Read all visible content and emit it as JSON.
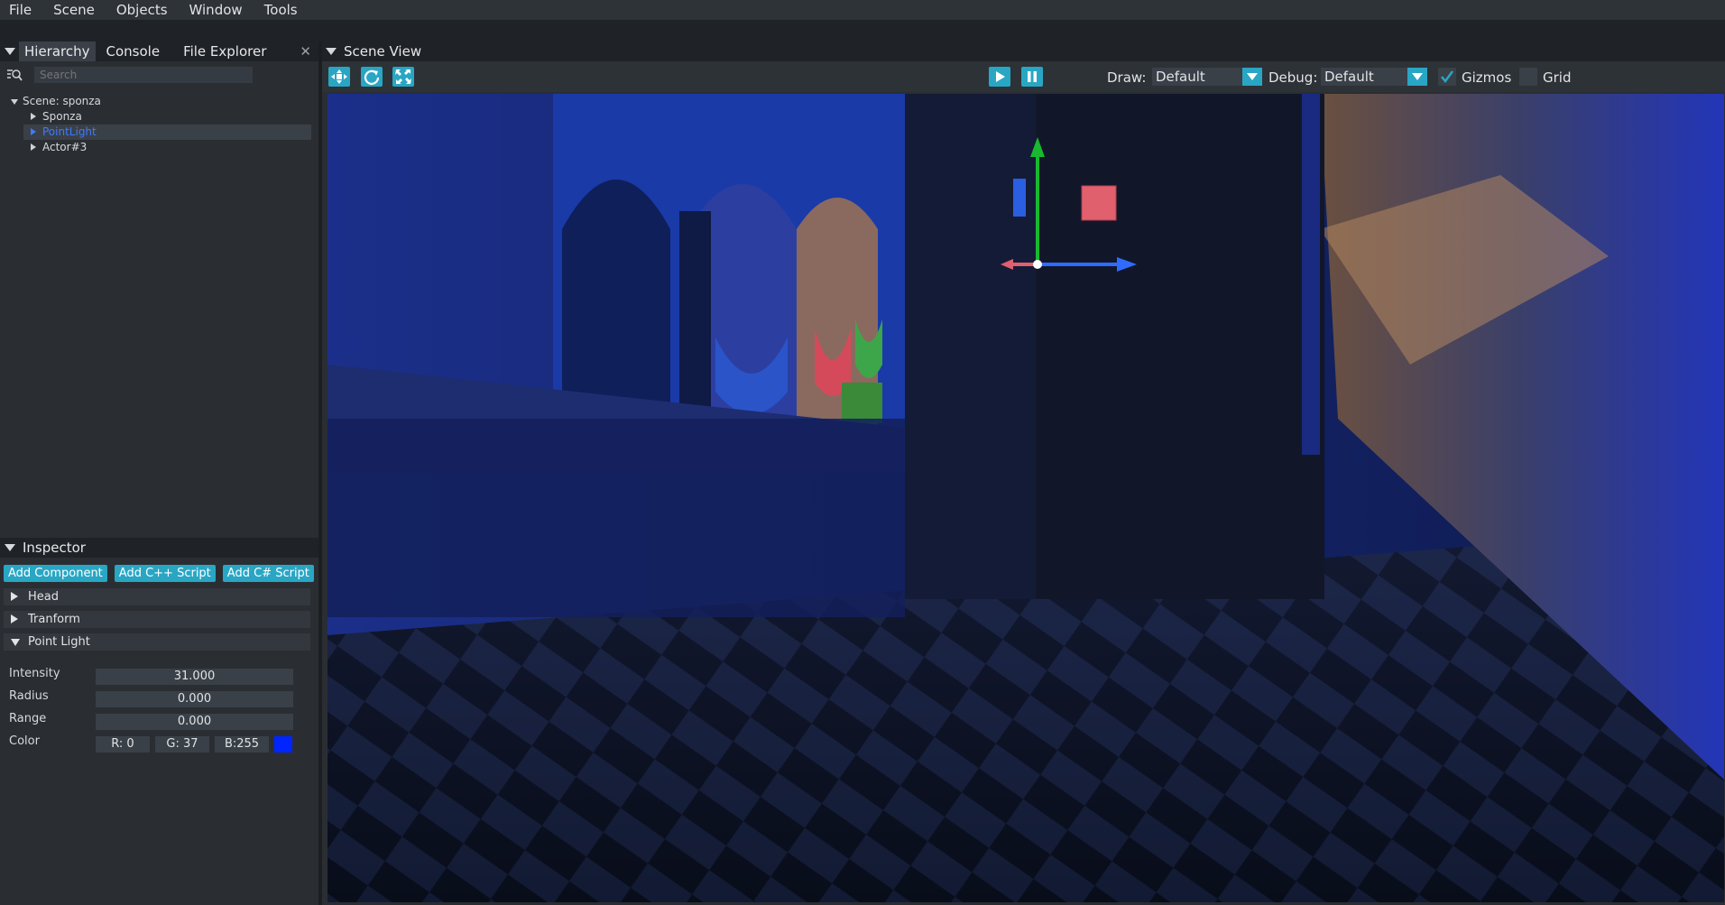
{
  "menu": [
    "File",
    "Scene",
    "Objects",
    "Window",
    "Tools"
  ],
  "left_tabs": {
    "hierarchy": "Hierarchy",
    "console": "Console",
    "file_explorer": "File Explorer",
    "close": "✕"
  },
  "search": {
    "placeholder": "Search"
  },
  "tree": {
    "scene": "Scene: sponza",
    "children": [
      "Sponza",
      "PointLight",
      "Actor#3"
    ],
    "selected_index": 1
  },
  "inspector": {
    "title": "Inspector",
    "buttons": [
      "Add Component",
      "Add C++ Script",
      "Add C# Script"
    ],
    "sections": [
      "Head",
      "Tranform",
      "Point Light"
    ],
    "props": {
      "intensity_label": "Intensity",
      "intensity": "31.000",
      "radius_label": "Radius",
      "radius": "0.000",
      "range_label": "Range",
      "range": "0.000",
      "color_label": "Color",
      "r": "R:  0",
      "g": "G: 37",
      "b": "B:255"
    },
    "color_hex": "#0025ff"
  },
  "scene_view": {
    "title": "Scene View",
    "draw_label": "Draw:",
    "draw_value": "Default",
    "debug_label": "Debug:",
    "debug_value": "Default",
    "gizmos_label": "Gizmos",
    "gizmos_checked": true,
    "grid_label": "Grid",
    "grid_checked": false
  },
  "colors": {
    "accent": "#29a6c4",
    "selected": "#3c7bff",
    "gizmo_x": "#2f6bff",
    "gizmo_y": "#18b830",
    "gizmo_neg": "#e0606e"
  }
}
